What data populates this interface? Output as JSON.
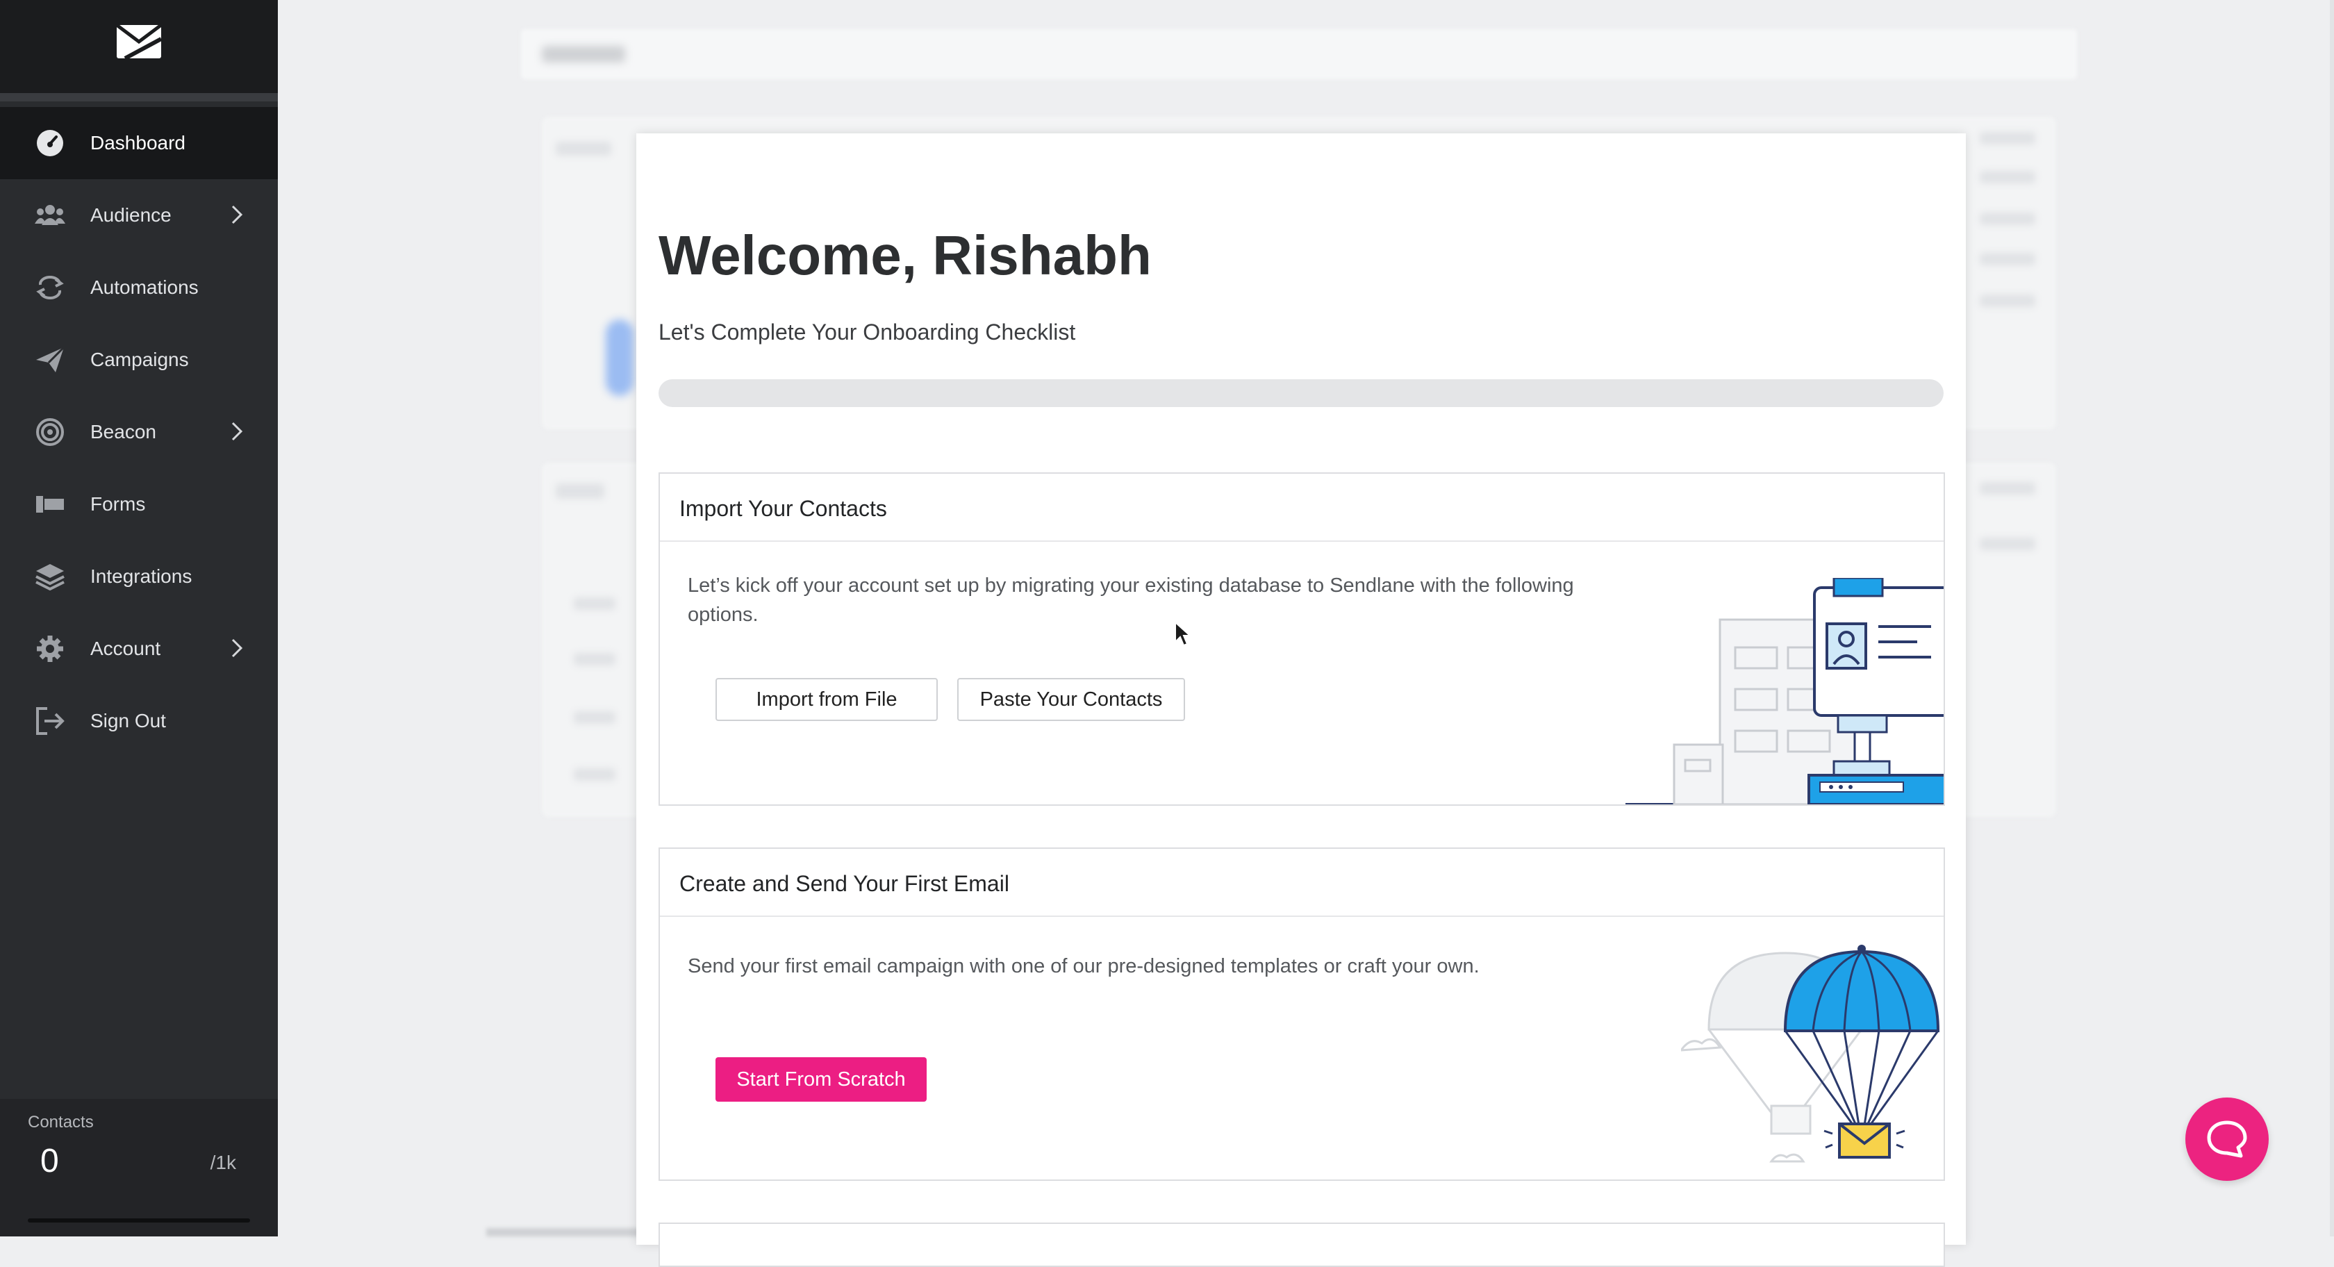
{
  "sidebar": {
    "logo_icon": "sendlane-logo-icon",
    "items": [
      {
        "label": "Dashboard",
        "icon": "dashboard-gauge-icon",
        "active": true,
        "has_submenu": false
      },
      {
        "label": "Audience",
        "icon": "users-icon",
        "active": false,
        "has_submenu": true
      },
      {
        "label": "Automations",
        "icon": "refresh-icon",
        "active": false,
        "has_submenu": false
      },
      {
        "label": "Campaigns",
        "icon": "paper-plane-icon",
        "active": false,
        "has_submenu": false
      },
      {
        "label": "Beacon",
        "icon": "beacon-radar-icon",
        "active": false,
        "has_submenu": true
      },
      {
        "label": "Forms",
        "icon": "forms-icon",
        "active": false,
        "has_submenu": false
      },
      {
        "label": "Integrations",
        "icon": "layers-icon",
        "active": false,
        "has_submenu": false
      },
      {
        "label": "Account",
        "icon": "gear-icon",
        "active": false,
        "has_submenu": true
      },
      {
        "label": "Sign Out",
        "icon": "sign-out-icon",
        "active": false,
        "has_submenu": false
      }
    ],
    "contacts": {
      "label": "Contacts",
      "count": "0",
      "limit": "/1k"
    }
  },
  "onboarding": {
    "title": "Welcome, Rishabh",
    "subtitle": "Let's Complete Your Onboarding Checklist",
    "progress_percent": 0,
    "cards": [
      {
        "title": "Import Your Contacts",
        "description": "Let’s kick off your account set up by migrating your existing database to Sendlane with the following options.",
        "buttons": [
          "Import from File",
          "Paste Your Contacts"
        ],
        "illustration": "contact-card-illustration"
      },
      {
        "title": "Create and Send Your First Email",
        "description": "Send your first email campaign with one of our pre-designed templates or craft your own.",
        "buttons": [
          "Start From Scratch"
        ],
        "illustration": "parachute-envelope-illustration"
      }
    ]
  },
  "help_button": {
    "icon": "chat-bubble-icon"
  },
  "colors": {
    "accent": "#ec1e83",
    "sidebar_bg": "#2a2c2f",
    "sidebar_active_bg": "#17181a",
    "illustration_blue": "#1ea1e8",
    "illustration_navy": "#2b3a6b"
  }
}
